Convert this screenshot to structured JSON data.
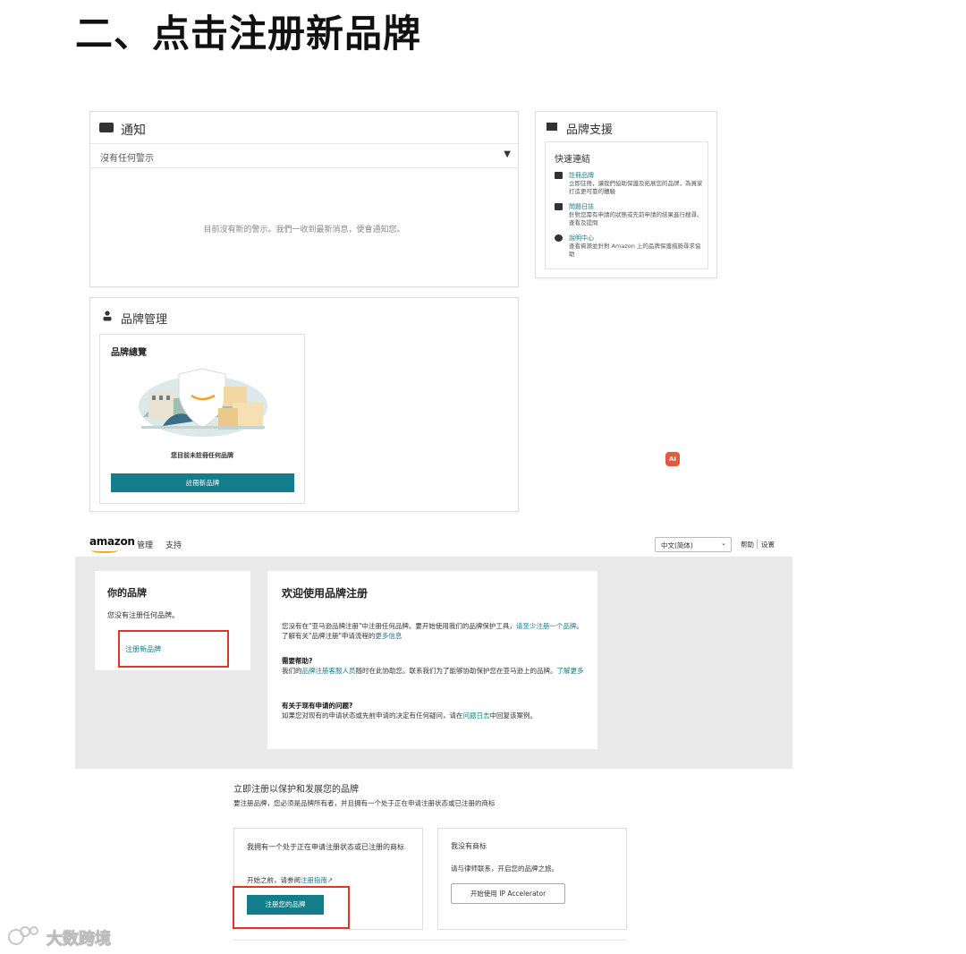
{
  "heading": "二、点击注册新品牌",
  "top_shot": {
    "notice": {
      "title": "通知",
      "filter_label": "沒有任何警示",
      "filter_caret": "▼",
      "empty_text": "目前沒有新的警示。我們一收到最新消息，便會通知您。"
    },
    "support": {
      "title": "品牌支援",
      "quicklinks_title": "快速連結",
      "items": [
        {
          "label": "註冊品牌",
          "desc": "立即註冊，讓我們協助保護及拓展您的品牌，為買家打造更可靠的體驗"
        },
        {
          "label": "問題日誌",
          "desc": "針對您需有申請的狀態或先前申請的結果進行搜尋、查看及提問"
        },
        {
          "label": "說明中心",
          "desc": "查看資源並針對 Amazon 上的品牌保護措施尋求協助"
        }
      ]
    },
    "brand_management": {
      "title": "品牌管理",
      "card_title": "品牌總覽",
      "empty_text": "您目前未註冊任何品牌",
      "button": "註冊新品牌"
    },
    "ai_badge": "AI"
  },
  "bottom_shot": {
    "topbar": {
      "logo": "amazon",
      "nav_manage": "管理",
      "nav_support": "支持",
      "language": "中文(简体)",
      "language_caret": "⌄",
      "help": "帮助",
      "settings": "设置"
    },
    "your_brand": {
      "title": "你的品牌",
      "desc": "您没有注册任何品牌。",
      "button": "注册新品牌"
    },
    "welcome": {
      "title": "欢迎使用品牌注册",
      "p1_text": "您没有在\"亚马逊品牌注册\"中注册任何品牌。要开始使用我们的品牌保护工具，",
      "p1_link": "请至少注册一个品牌",
      "p1_tail": "。了解有关\"品牌注册\"申请流程的",
      "p1_link2": "更多信息",
      "p2_title": "需要帮助?",
      "p2_pre": "我们的",
      "p2_link": "品牌注册客服人员",
      "p2_text": "随时在此协助您。联系我们为了能够协助保护您在亚马逊上的品牌。",
      "p2_link2": "了解更多",
      "p3_title": "有关于现有申请的问题?",
      "p3_text": "如果您对现有的申请状态或先前申请的决定有任何疑问，请在",
      "p3_link": "问题日志",
      "p3_tail": "中回复该案例。"
    },
    "register_section": {
      "title": "立即注册以保护和发展您的品牌",
      "desc": "要注册品牌，您必须是品牌所有者，并且拥有一个处于正在申请注册状态或已注册的商标"
    },
    "card_have": {
      "text": "我拥有一个处于正在申请注册状态或已注册的商标",
      "guide_pre": "开始之前，请参阅",
      "guide_link": "注册指南",
      "guide_icon": "↗",
      "button": "注册您的品牌"
    },
    "card_none": {
      "title": "我没有商标",
      "desc": "请与律师联系，开启您的品牌之旅。",
      "button": "开始使用 IP Accelerator"
    }
  },
  "watermark": "大数跨境"
}
